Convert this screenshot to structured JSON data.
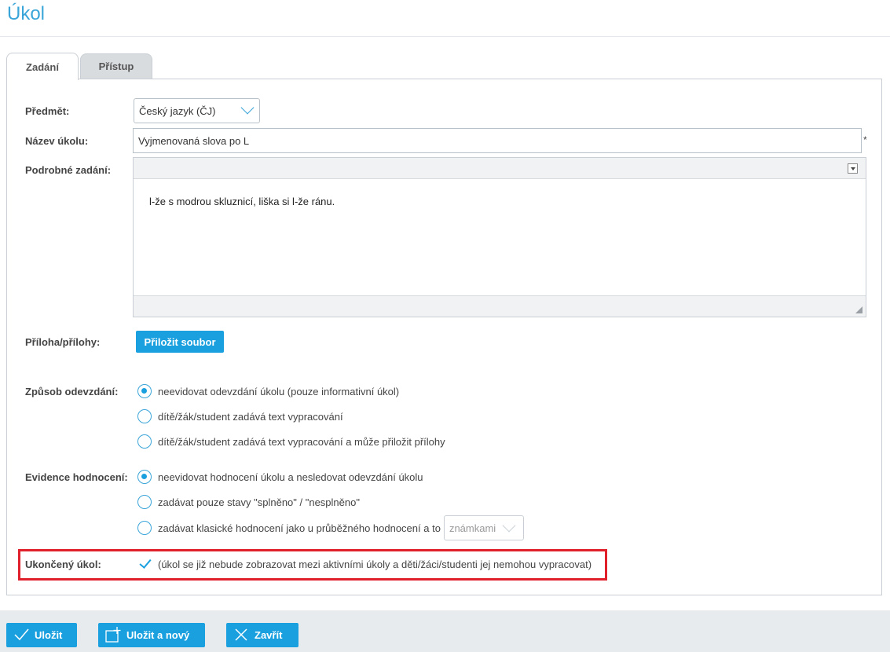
{
  "header": {
    "title": "Úkol"
  },
  "tabs": [
    {
      "label": "Zadání",
      "active": true
    },
    {
      "label": "Přístup",
      "active": false
    }
  ],
  "form": {
    "subject": {
      "label": "Předmět:",
      "value": "Český jazyk (ČJ)"
    },
    "name": {
      "label": "Název úkolu:",
      "value": "Vyjmenovaná slova po L",
      "required_mark": "*"
    },
    "details": {
      "label": "Podrobné zadání:",
      "text": "l-že s modrou skluznicí, liška si l-že ránu."
    },
    "attachments": {
      "label": "Příloha/přílohy:",
      "button": "Přiložit soubor"
    },
    "submission": {
      "label": "Způsob odevzdání:",
      "options": [
        {
          "label": "neevidovat odevzdání úkolu (pouze informativní úkol)",
          "checked": true
        },
        {
          "label": "dítě/žák/student zadává text vypracování",
          "checked": false
        },
        {
          "label": "dítě/žák/student zadává text vypracování a může přiložit přílohy",
          "checked": false
        }
      ]
    },
    "grading": {
      "label": "Evidence hodnocení:",
      "options": [
        {
          "label": "neevidovat hodnocení úkolu a nesledovat odevzdání úkolu",
          "checked": true
        },
        {
          "label": "zadávat pouze stavy \"splněno\" / \"nesplněno\"",
          "checked": false
        },
        {
          "label": "zadávat klasické hodnocení jako u průběžného hodnocení a to",
          "checked": false
        }
      ],
      "grade_select": "známkami"
    },
    "finished": {
      "label": "Ukončený úkol:",
      "checked": true,
      "note": "(úkol se již nebude zobrazovat mezi aktivními úkoly a děti/žáci/studenti jej nemohou vypracovat)"
    }
  },
  "footer": {
    "save": "Uložit",
    "save_new": "Uložit a nový",
    "close": "Zavřít"
  },
  "colors": {
    "accent": "#1aa0df",
    "highlight": "#e0202a"
  }
}
